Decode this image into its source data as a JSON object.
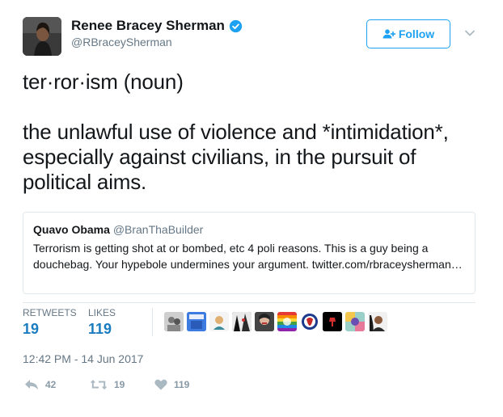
{
  "user": {
    "display_name": "Renee Bracey Sherman",
    "handle": "@RBraceySherman",
    "verified": true
  },
  "follow_button": {
    "label": "Follow"
  },
  "tweet": {
    "lines": [
      "ter·ror·ism (noun)",
      "the unlawful use of violence and *intimidation*, especially against civilians, in the pursuit of political aims."
    ]
  },
  "quoted_tweet": {
    "name": "Quavo Obama",
    "handle": "@BranThaBuilder",
    "text": "Terrorism is getting shot at or bombed, etc 4 poli reasons. This is a guy being a douchebag. Your hypebole undermines your argument. twitter.com/rbraceysherman…"
  },
  "stats": {
    "retweets_label": "RETWEETS",
    "retweets_value": "19",
    "likes_label": "LIKES",
    "likes_value": "119"
  },
  "timestamp": "12:42 PM - 14 Jun 2017",
  "actions": {
    "reply_count": "42",
    "retweet_count": "19",
    "like_count": "119"
  },
  "colors": {
    "accent": "#1da1f2",
    "stat_value": "#1b7cbf",
    "muted": "#657786",
    "action": "#8899a6",
    "border": "#e1e8ed"
  }
}
